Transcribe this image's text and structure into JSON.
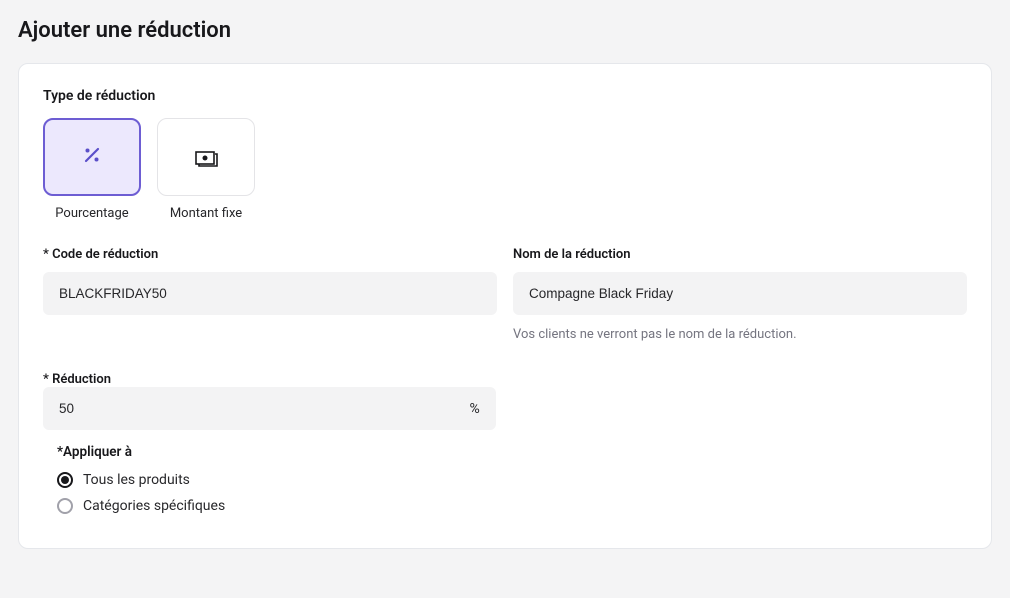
{
  "page_title": "Ajouter une réduction",
  "type_section": {
    "label": "Type de réduction",
    "options": {
      "percentage": {
        "caption": "Pourcentage"
      },
      "fixed": {
        "caption": "Montant fixe"
      }
    }
  },
  "fields": {
    "code": {
      "label": "* Code de réduction",
      "value": "BLACKFRIDAY50"
    },
    "name": {
      "label": "Nom de la réduction",
      "value": "Compagne Black Friday",
      "hint": "Vos clients ne verront pas le nom de la réduction."
    },
    "reduction": {
      "label": "* Réduction",
      "value": "50",
      "suffix": "%"
    },
    "apply_to": {
      "label": "*Appliquer à",
      "options": {
        "all": "Tous les produits",
        "categories": "Catégories spécifiques"
      }
    }
  }
}
